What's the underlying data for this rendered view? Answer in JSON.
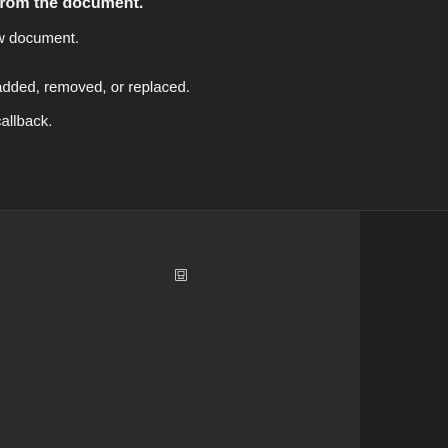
{
  "document": {
    "lines": [
      "from the document.",
      "w document.",
      "added, removed, or replaced.",
      "callback."
    ]
  },
  "panel": {
    "icon": "inspect-icon",
    "colors": {
      "background": "#2b2b2b",
      "text": "#f2f2f2"
    }
  }
}
